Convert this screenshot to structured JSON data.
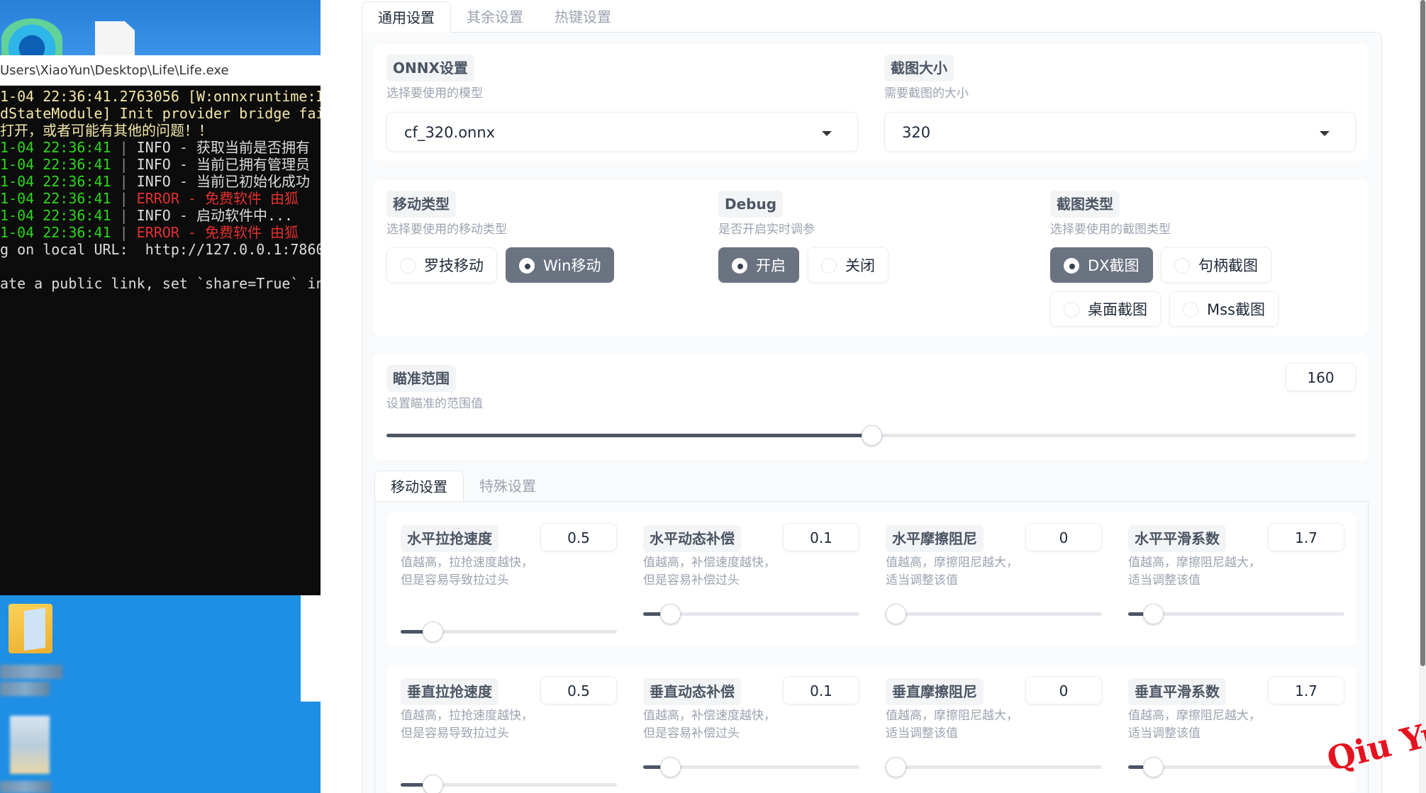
{
  "console": {
    "title": "Users\\XiaoYun\\Desktop\\Life\\Life.exe",
    "lines": [
      {
        "segs": [
          {
            "t": "1-04 22:36:41.2763056 [W:onnxruntime:I",
            "c": "c-yellow"
          }
        ]
      },
      {
        "segs": [
          {
            "t": "dStateModule] Init provider bridge fai",
            "c": "c-yellow"
          }
        ]
      },
      {
        "segs": [
          {
            "t": "打开，或者可能有其他的问题！！",
            "c": "c-yellow"
          }
        ]
      },
      {
        "segs": [
          {
            "t": "1-04 22:36:41",
            "c": "c-green"
          },
          {
            "t": " | ",
            "c": "c-pipe"
          },
          {
            "t": "INFO",
            "c": "c-white"
          },
          {
            "t": " - 获取当前是否拥有",
            "c": "c-white"
          }
        ]
      },
      {
        "segs": [
          {
            "t": "1-04 22:36:41",
            "c": "c-green"
          },
          {
            "t": " | ",
            "c": "c-pipe"
          },
          {
            "t": "INFO",
            "c": "c-white"
          },
          {
            "t": " - 当前已拥有管理员",
            "c": "c-white"
          }
        ]
      },
      {
        "segs": [
          {
            "t": "1-04 22:36:41",
            "c": "c-green"
          },
          {
            "t": " | ",
            "c": "c-pipe"
          },
          {
            "t": "INFO",
            "c": "c-white"
          },
          {
            "t": " - 当前已初始化成功",
            "c": "c-white"
          }
        ]
      },
      {
        "segs": [
          {
            "t": "1-04 22:36:41",
            "c": "c-green"
          },
          {
            "t": " | ",
            "c": "c-pipe"
          },
          {
            "t": "ERROR",
            "c": "c-red"
          },
          {
            "t": " - 免费软件 由狐",
            "c": "c-red"
          }
        ]
      },
      {
        "segs": [
          {
            "t": "1-04 22:36:41",
            "c": "c-green"
          },
          {
            "t": " | ",
            "c": "c-pipe"
          },
          {
            "t": "INFO",
            "c": "c-white"
          },
          {
            "t": " - 启动软件中...",
            "c": "c-white"
          }
        ]
      },
      {
        "segs": [
          {
            "t": "1-04 22:36:41",
            "c": "c-green"
          },
          {
            "t": " | ",
            "c": "c-pipe"
          },
          {
            "t": "ERROR",
            "c": "c-red"
          },
          {
            "t": " - 免费软件 由狐",
            "c": "c-red"
          }
        ]
      },
      {
        "segs": [
          {
            "t": "g on local URL:  http://127.0.0.1:7860",
            "c": "c-white"
          }
        ]
      },
      {
        "segs": [
          {
            "t": "",
            "c": "c-white"
          }
        ]
      },
      {
        "segs": [
          {
            "t": "ate a public link, set `share=True` in",
            "c": "c-white"
          }
        ]
      }
    ]
  },
  "tabs": [
    {
      "label": "通用设置",
      "active": true
    },
    {
      "label": "其余设置",
      "active": false
    },
    {
      "label": "热键设置",
      "active": false
    }
  ],
  "onnx": {
    "title": "ONNX设置",
    "desc": "选择要使用的模型",
    "value": "cf_320.onnx"
  },
  "capture_size": {
    "title": "截图大小",
    "desc": "需要截图的大小",
    "value": "320"
  },
  "move_type": {
    "title": "移动类型",
    "desc": "选择要使用的移动类型",
    "options": [
      {
        "label": "罗技移动",
        "selected": false
      },
      {
        "label": "Win移动",
        "selected": true
      }
    ]
  },
  "debug": {
    "title": "Debug",
    "desc": "是否开启实时调参",
    "options": [
      {
        "label": "开启",
        "selected": true
      },
      {
        "label": "关闭",
        "selected": false
      }
    ]
  },
  "capture_type": {
    "title": "截图类型",
    "desc": "选择要使用的截图类型",
    "options": [
      {
        "label": "DX截图",
        "selected": true
      },
      {
        "label": "句柄截图",
        "selected": false
      },
      {
        "label": "桌面截图",
        "selected": false
      },
      {
        "label": "Mss截图",
        "selected": false
      }
    ]
  },
  "aim_range": {
    "title": "瞄准范围",
    "desc": "设置瞄准的范围值",
    "value": "160",
    "fraction": 0.5
  },
  "subtabs": [
    {
      "label": "移动设置",
      "active": true
    },
    {
      "label": "特殊设置",
      "active": false
    }
  ],
  "params": [
    {
      "title": "水平拉抢速度",
      "value": "0.5",
      "desc": "值越高，拉抢速度越快，但是容易导致拉过头",
      "fraction": 0.1
    },
    {
      "title": "水平动态补偿",
      "value": "0.1",
      "desc": "值越高，补偿速度越快，但是容易补偿过头",
      "fraction": 0.08
    },
    {
      "title": "水平摩擦阻尼",
      "value": "0",
      "desc": "值越高，摩擦阻尼越大，适当调整该值",
      "fraction": 0.0
    },
    {
      "title": "水平平滑系数",
      "value": "1.7",
      "desc": "值越高，摩擦阻尼越大，适当调整该值",
      "fraction": 0.07
    },
    {
      "title": "垂直拉抢速度",
      "value": "0.5",
      "desc": "值越高，拉抢速度越快，但是容易导致拉过头",
      "fraction": 0.1
    },
    {
      "title": "垂直动态补偿",
      "value": "0.1",
      "desc": "值越高，补偿速度越快，但是容易补偿过头",
      "fraction": 0.08
    },
    {
      "title": "垂直摩擦阻尼",
      "value": "0",
      "desc": "值越高，摩擦阻尼越大，适当调整该值",
      "fraction": 0.0
    },
    {
      "title": "垂直平滑系数",
      "value": "1.7",
      "desc": "值越高，摩擦阻尼越大，适当调整该值",
      "fraction": 0.07
    }
  ],
  "watermark": "Qiu Yue"
}
